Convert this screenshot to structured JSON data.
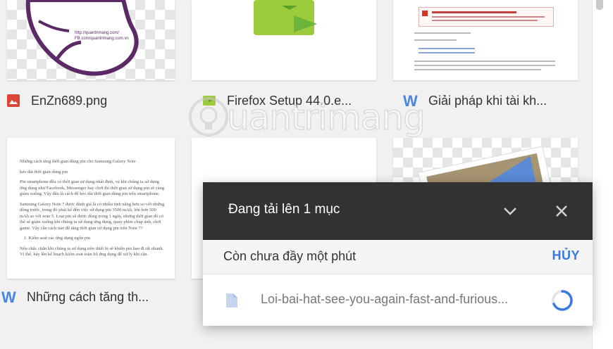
{
  "files": [
    {
      "name": "EnZn689.png",
      "type": "image",
      "thumb_caption": "http://quantrimang.com/\nFB.com/quantrimang.com.vn"
    },
    {
      "name": "Firefox Setup 44.0.e...",
      "type": "installer"
    },
    {
      "name": "Giải pháp khi tài kh...",
      "type": "word"
    },
    {
      "name": "Những cách tăng th...",
      "type": "word",
      "preview": {
        "title": "Những cách tăng thời gian dùng pin cho Samsung Galaxy Note",
        "subtitle": "kéo dài thời gian dùng pin",
        "p1": "Pin smartphone đều có thời gian sử dụng nhất định, và khi chúng ta sử dụng ứng dụng như Facebook, Messenger hay chơi thì thời gian sử dụng pin sẽ càng giảm xuống. Vậy đâu là cách để kéo dài thời gian dùng pin trên smartphone.",
        "p2": "Samsung Galaxy Note 7 được đánh giá là có nhiều tính năng hơn so với những dòng trước, trong đó phải kể đến việc sử dụng pin 3500 mAh, lớn hơn 500 mAh so với note 5. Loại pin sẽ được dùng trong 1 ngày, nhưng thời gian đó có thể sẽ giảm xuống khi chúng ta sử dụng ứng dụng, quay phim chụp ảnh, chơi game. Vậy cần cách nào để tăng thời gian sử dụng pin trên Note 7?",
        "li": "1.   Kiểm soát các ứng dụng ngốn pin",
        "p3": "Nếu chắc chắn khi chúng ta sử dụng trên thiết bị sẽ khiến pin hao đi rất nhanh. Vì thế, hãy lên kế hoạch kiểm soát toàn bộ ứng dụng để xử lý khi cần."
      }
    },
    {
      "name": "",
      "type": "blank"
    },
    {
      "name": "",
      "type": "image"
    }
  ],
  "upload_panel": {
    "title": "Đang tải lên 1 mục",
    "status": "Còn chưa đầy một phút",
    "cancel_label": "HỦY",
    "items": [
      {
        "name": "Loi-bai-hat-see-you-again-fast-and-furious..."
      }
    ]
  },
  "watermark": {
    "brand": "uantrimang"
  },
  "colors": {
    "header_bg": "#323232",
    "accent": "#3b78e7",
    "word_blue": "#4a86e8",
    "firefox_green": "#9ccc3c",
    "image_red": "#db4437",
    "glove_purple": "#5b2a66"
  }
}
